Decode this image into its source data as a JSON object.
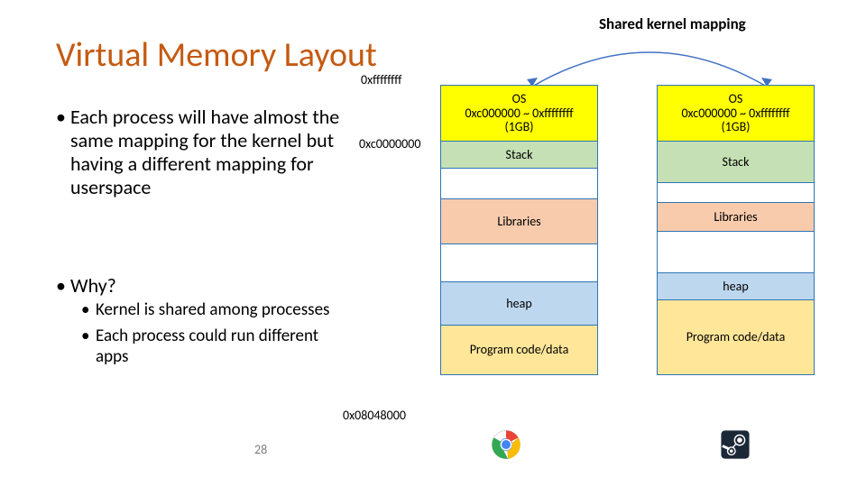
{
  "title": "Virtual Memory Layout",
  "addresses": {
    "top": "0xffffffff",
    "kernel_base": "0xc0000000",
    "user_base": "0x08048000"
  },
  "bullets": {
    "b1": "Each process will have almost the same mapping for the kernel but having a different mapping for userspace",
    "b2": "Why?",
    "sub1": "Kernel is shared among processes",
    "sub2": "Each process could run different apps"
  },
  "shared_label": "Shared kernel mapping",
  "segments": {
    "os_line1": "OS",
    "os_line2": "0xc000000 ~ 0xffffffff",
    "os_line3": "(1GB)",
    "stack": "Stack",
    "libraries": "Libraries",
    "heap": "heap",
    "code": "Program code/data"
  },
  "page_number": "28"
}
